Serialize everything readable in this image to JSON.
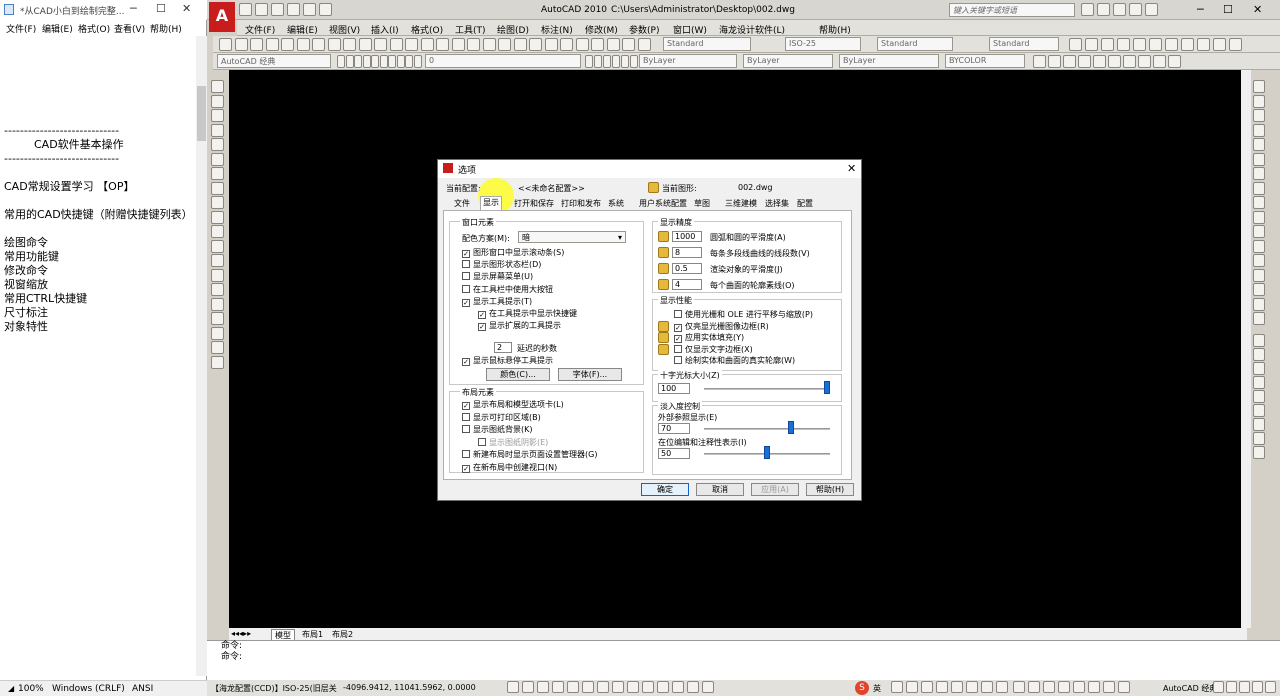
{
  "notepad": {
    "title": "*从CAD小白到绘制完整...",
    "menu": [
      "文件(F)",
      "编辑(E)",
      "格式(O)",
      "查看(V)",
      "帮助(H)"
    ],
    "lines": [
      "",
      "",
      "",
      "",
      "",
      "",
      "-----------------------------",
      "CAD软件基本操作",
      "-----------------------------",
      "",
      "CAD常规设置学习 【OP】",
      "",
      "常用的CAD快捷键（附赠快捷键列表）",
      "",
      "绘图命令",
      "常用功能键",
      "修改命令",
      "视窗缩放",
      "常用CTRL快捷键",
      "尺寸标注",
      "对象特性"
    ],
    "status": {
      "zoom": "100%",
      "eol": "Windows (CRLF)",
      "encoding": "ANSI"
    }
  },
  "acad": {
    "app_title": "AutoCAD 2010",
    "file_path": "C:\\Users\\Administrator\\Desktop\\002.dwg",
    "search_placeholder": "键入关键字或短语",
    "menu": [
      "文件(F)",
      "编辑(E)",
      "视图(V)",
      "插入(I)",
      "格式(O)",
      "工具(T)",
      "绘图(D)",
      "标注(N)",
      "修改(M)",
      "参数(P)",
      "窗口(W)",
      "海龙设计软件(L)",
      "帮助(H)"
    ],
    "styles": {
      "text": "Standard",
      "dim": "ISO-25",
      "table": "Standard",
      "multileader": "Standard"
    },
    "workspace": "AutoCAD 经典",
    "layer": "0",
    "color": "ByLayer",
    "linetype": "ByLayer",
    "lineweight": "ByLayer",
    "plotstyle": "BYCOLOR",
    "layout_tabs": [
      "模型",
      "布局1",
      "布局2"
    ],
    "cmd_lines": [
      "命令:",
      "命令:"
    ],
    "status_text": "【海龙配置(CCD)】ISO-25(旧层关",
    "coords": "-4096.9412, 11041.5962, 0.0000",
    "status_right": "AutoCAD 经典",
    "ime": "英"
  },
  "dialog": {
    "title": "选项",
    "current_profile_label": "当前配置:",
    "current_profile": "<<未命名配置>>",
    "current_drawing_label": "当前图形:",
    "current_drawing": "002.dwg",
    "tabs": [
      "文件",
      "显示",
      "打开和保存",
      "打印和发布",
      "系统",
      "用户系统配置",
      "草图",
      "三维建模",
      "选择集",
      "配置"
    ],
    "window_elements": {
      "title": "窗口元素",
      "color_scheme_label": "配色方案(M):",
      "color_scheme": "暗",
      "options": [
        {
          "label": "图形窗口中显示滚动条(S)",
          "checked": true
        },
        {
          "label": "显示图形状态栏(D)",
          "checked": false
        },
        {
          "label": "显示屏幕菜单(U)",
          "checked": false
        },
        {
          "label": "在工具栏中使用大按钮",
          "checked": false
        },
        {
          "label": "显示工具提示(T)",
          "checked": true
        },
        {
          "label": "在工具提示中显示快捷键",
          "checked": true
        },
        {
          "label": "显示扩展的工具提示",
          "checked": true
        }
      ],
      "delay_value": "2",
      "delay_label": "延迟的秒数",
      "rollover_label": "显示鼠标悬停工具提示",
      "rollover_checked": true,
      "colors_btn": "颜色(C)...",
      "fonts_btn": "字体(F)..."
    },
    "layout_elements": {
      "title": "布局元素",
      "options": [
        {
          "label": "显示布局和模型选项卡(L)",
          "checked": true
        },
        {
          "label": "显示可打印区域(B)",
          "checked": false
        },
        {
          "label": "显示图纸背景(K)",
          "checked": false
        },
        {
          "label": "显示图纸阴影(E)",
          "checked": false,
          "disabled": true
        },
        {
          "label": "新建布局时显示页面设置管理器(G)",
          "checked": false
        },
        {
          "label": "在新布局中创建视口(N)",
          "checked": true
        }
      ]
    },
    "display_resolution": {
      "title": "显示精度",
      "items": [
        {
          "value": "1000",
          "label": "圆弧和圆的平滑度(A)"
        },
        {
          "value": "8",
          "label": "每条多段线曲线的线段数(V)"
        },
        {
          "value": "0.5",
          "label": "渲染对象的平滑度(J)"
        },
        {
          "value": "4",
          "label": "每个曲面的轮廓素线(O)"
        }
      ]
    },
    "display_performance": {
      "title": "显示性能",
      "options": [
        {
          "label": "使用光栅和 OLE 进行平移与缩放(P)",
          "checked": false
        },
        {
          "label": "仅亮显光栅图像边框(R)",
          "checked": true
        },
        {
          "label": "应用实体填充(Y)",
          "checked": true
        },
        {
          "label": "仅显示文字边框(X)",
          "checked": false
        },
        {
          "label": "绘制实体和曲面的真实轮廓(W)",
          "checked": false
        }
      ]
    },
    "crosshair": {
      "title": "十字光标大小(Z)",
      "value": "100",
      "level": 100
    },
    "fade": {
      "title": "淡入度控制",
      "xref_label": "外部参照显示(E)",
      "xref_value": "70",
      "xref_level": 70,
      "inplace_label": "在位编辑和注释性表示(I)",
      "inplace_value": "50",
      "inplace_level": 50
    },
    "buttons": {
      "ok": "确定",
      "cancel": "取消",
      "apply": "应用(A)",
      "help": "帮助(H)"
    }
  }
}
